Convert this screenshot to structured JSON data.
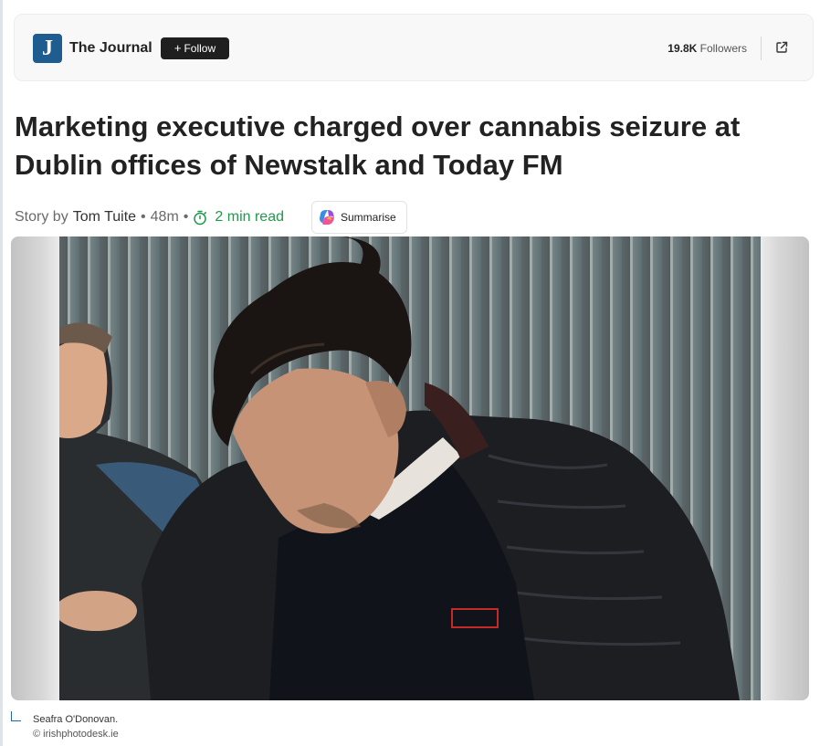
{
  "publisher": {
    "logo_letter": "J",
    "name": "The Journal",
    "follow_label": "Follow",
    "followers_count": "19.8K",
    "followers_label": "Followers",
    "brand_color": "#1f5d91"
  },
  "article": {
    "headline": "Marketing executive charged over cannabis seizure at Dublin offices of Newstalk and Today FM",
    "byline_prefix": "Story by",
    "author": "Tom Tuite",
    "age": "48m",
    "read_time": "2 min read",
    "summarise_label": "Summarise"
  },
  "image": {
    "caption": "Seafra O'Donovan.",
    "credit": "© irishphotodesk.ie"
  },
  "icons": {
    "open_external": "external-link-icon",
    "timer": "stopwatch-icon",
    "summarise": "copilot-icon"
  },
  "colors": {
    "read_time": "#1e9a4a",
    "follow_button": "#1f1f1f"
  }
}
